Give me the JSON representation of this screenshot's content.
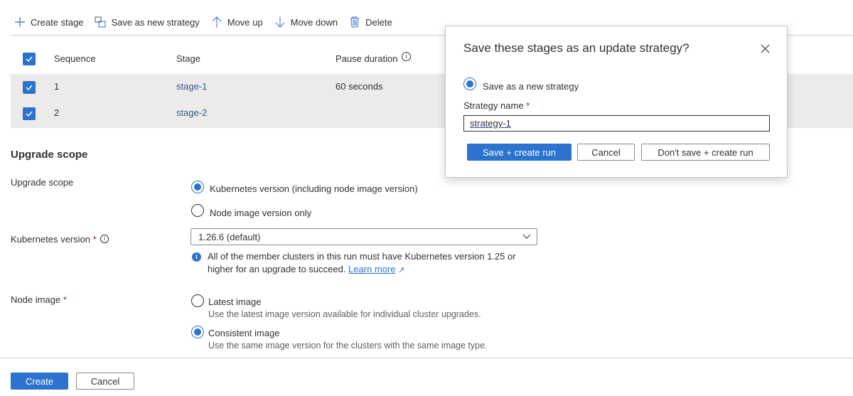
{
  "toolbar": {
    "create_stage": "Create stage",
    "save_strategy": "Save as new strategy",
    "move_up": "Move up",
    "move_down": "Move down",
    "delete": "Delete"
  },
  "table": {
    "headers": {
      "sequence": "Sequence",
      "stage": "Stage",
      "pause": "Pause duration"
    },
    "rows": [
      {
        "sequence": "1",
        "stage": "stage-1",
        "pause": "60 seconds"
      },
      {
        "sequence": "2",
        "stage": "stage-2",
        "pause": ""
      }
    ]
  },
  "scope": {
    "heading": "Upgrade scope",
    "label": "Upgrade scope",
    "opt1": "Kubernetes version (including node image version)",
    "opt2": "Node image version only",
    "k8s_label": "Kubernetes version",
    "k8s_value": "1.26.6 (default)",
    "info1": "All of the member clusters in this run must have Kubernetes version 1.25 or",
    "info2": "higher for an upgrade to succeed.",
    "learn_more": "Learn more",
    "node_label": "Node image",
    "latest": "Latest image",
    "latest_desc": "Use the latest image version available for individual cluster upgrades.",
    "consistent": "Consistent image",
    "consistent_desc": "Use the same image version for the clusters with the same image type.",
    "required": "*"
  },
  "footer": {
    "create": "Create",
    "cancel": "Cancel"
  },
  "dialog": {
    "title": "Save these stages as an update strategy?",
    "radio": "Save as a new strategy",
    "name_label": "Strategy name",
    "name_value": "strategy-1",
    "save": "Save + create run",
    "cancel": "Cancel",
    "dont_save": "Don't save + create run"
  },
  "colors": {
    "accent": "#2b73cf"
  }
}
